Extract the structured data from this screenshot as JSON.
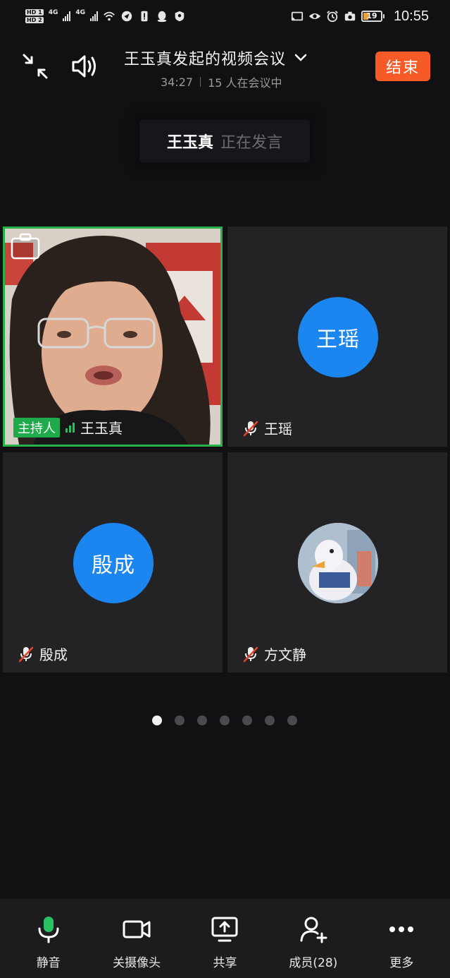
{
  "statusbar": {
    "hd1": "HD 1",
    "hd2": "HD 2",
    "net1": "4G",
    "net2": "4G",
    "battery": "19",
    "time": "10:55"
  },
  "header": {
    "title": "王玉真发起的视频会议",
    "duration": "34:27",
    "participants": "15 人在会议中",
    "end_label": "结束"
  },
  "speaking": {
    "name": "王玉真",
    "status": "正在发言"
  },
  "tiles": [
    {
      "name": "王玉真",
      "host_label": "主持人",
      "video": true
    },
    {
      "name": "王瑶",
      "avatar_text": "王瑶",
      "muted": true
    },
    {
      "name": "殷成",
      "avatar_text": "殷成",
      "muted": true
    },
    {
      "name": "方文静",
      "muted": true,
      "photo": true
    }
  ],
  "pager": {
    "count": 7,
    "active": 0
  },
  "toolbar": {
    "mute": "静音",
    "camera": "关摄像头",
    "share": "共享",
    "members": "成员(28)",
    "more": "更多"
  },
  "colors": {
    "accent_end": "#f55a27",
    "avatar_blue": "#1b86f0",
    "host_green": "#1faa4b",
    "speaker_border": "#26b44a"
  }
}
